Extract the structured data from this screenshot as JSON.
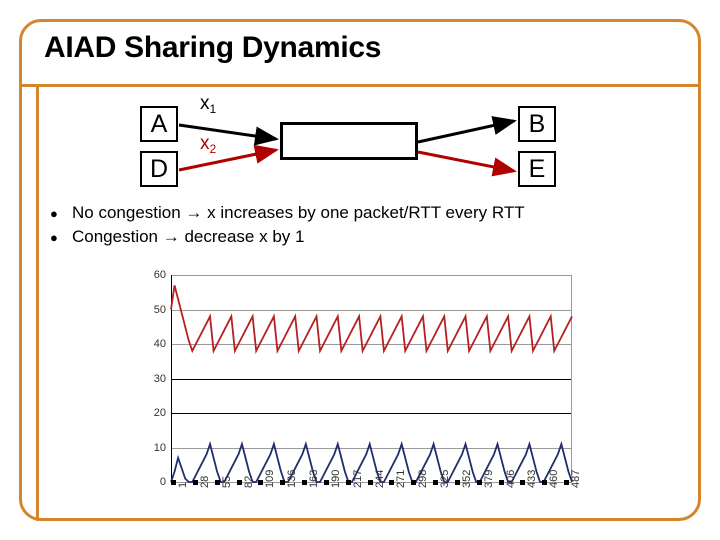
{
  "slide": {
    "title": "AIAD Sharing Dynamics",
    "frame_color": "#d4862a"
  },
  "diagram": {
    "nodes": [
      {
        "id": "A",
        "label": "A"
      },
      {
        "id": "D",
        "label": "D"
      },
      {
        "id": "B",
        "label": "B"
      },
      {
        "id": "E",
        "label": "E"
      }
    ],
    "router_label": "",
    "flows": [
      {
        "name": "x1",
        "base": "x",
        "sub": "1",
        "color": "#000000",
        "from": "A",
        "to": "B"
      },
      {
        "name": "x2",
        "base": "x",
        "sub": "2",
        "color": "#b00000",
        "from": "D",
        "to": "E"
      }
    ]
  },
  "bullets": [
    {
      "marker": "●",
      "text": "No congestion → x increases by one packet/RTT every RTT"
    },
    {
      "marker": "●",
      "text": "Congestion → decrease x by 1"
    }
  ],
  "chart_data": {
    "type": "line",
    "title": "",
    "xlabel": "",
    "ylabel": "",
    "xlim": [
      1,
      500
    ],
    "ylim": [
      0,
      60
    ],
    "grid": true,
    "legend": "none",
    "yticks": [
      0,
      10,
      20,
      30,
      40,
      50,
      60
    ],
    "xticks": [
      1,
      28,
      55,
      82,
      109,
      136,
      163,
      190,
      217,
      244,
      271,
      298,
      325,
      352,
      379,
      406,
      433,
      460,
      487
    ],
    "series": [
      {
        "name": "x2",
        "color": "#b52020",
        "description": "Red sawtooth: starts at 50, rises to peak 57, then settles into a repeating sawtooth oscillating between about 38 and 48.",
        "values": [
          50,
          57,
          53,
          49,
          45,
          41,
          38,
          40,
          42,
          44,
          46,
          48,
          38,
          40,
          42,
          44,
          46,
          48,
          38,
          40,
          42,
          44,
          46,
          48,
          38,
          40,
          42,
          44,
          46,
          48,
          38,
          40,
          42,
          44,
          46,
          48,
          38,
          40,
          42,
          44,
          46,
          48,
          38,
          40,
          42,
          44,
          46,
          48,
          38,
          40,
          42,
          44,
          46,
          48,
          38,
          40,
          42,
          44,
          46,
          48,
          38,
          40,
          42,
          44,
          46,
          48,
          38,
          40,
          42,
          44,
          46,
          48,
          38,
          40,
          42,
          44,
          46,
          48,
          38,
          40,
          42,
          44,
          46,
          48,
          38,
          40,
          42,
          44,
          46,
          48,
          38,
          40,
          42,
          44,
          46,
          48,
          38,
          40,
          42,
          44,
          46,
          48,
          38,
          40,
          42,
          44,
          46,
          48,
          38,
          40,
          42,
          44,
          46,
          48
        ]
      },
      {
        "name": "x1",
        "color": "#1f2f6e",
        "description": "Blue sawtooth: starts at 0, rises to a small peak near 7, drops to 0, then repeats a sawtooth rising from 0 to about 11 and dropping back to 0.",
        "values": [
          0,
          3,
          7,
          4,
          1,
          0,
          0,
          2,
          4,
          6,
          8,
          11,
          7,
          3,
          0,
          0,
          2,
          4,
          6,
          8,
          11,
          7,
          3,
          0,
          0,
          2,
          4,
          6,
          8,
          11,
          7,
          3,
          0,
          0,
          2,
          4,
          6,
          8,
          11,
          7,
          3,
          0,
          0,
          2,
          4,
          6,
          8,
          11,
          7,
          3,
          0,
          0,
          2,
          4,
          6,
          8,
          11,
          7,
          3,
          0,
          0,
          2,
          4,
          6,
          8,
          11,
          7,
          3,
          0,
          0,
          2,
          4,
          6,
          8,
          11,
          7,
          3,
          0,
          0,
          2,
          4,
          6,
          8,
          11,
          7,
          3,
          0,
          0,
          2,
          4,
          6,
          8,
          11,
          7,
          3,
          0,
          0,
          2,
          4,
          6,
          8,
          11,
          7,
          3,
          0,
          0,
          2,
          4,
          6,
          8,
          11,
          7,
          3,
          0
        ]
      }
    ]
  }
}
